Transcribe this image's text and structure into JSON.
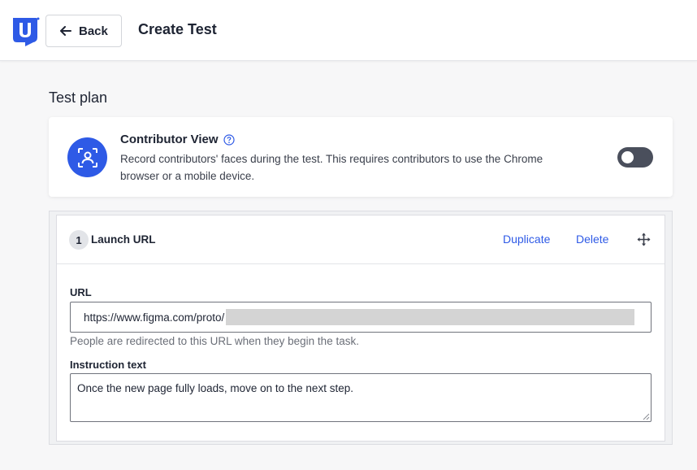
{
  "header": {
    "back_label": "Back",
    "title": "Create Test",
    "logo_icon": "usertesting-logo-icon"
  },
  "section": {
    "title": "Test plan"
  },
  "contributor_view": {
    "title": "Contributor View",
    "description": "Record contributors' faces during the test. This requires contributors to use the Chrome browser or a mobile device.",
    "icon": "contributor-face-icon",
    "help_icon": "help-icon",
    "toggle_enabled": false
  },
  "step": {
    "number": "1",
    "name": "Launch URL",
    "duplicate_label": "Duplicate",
    "delete_label": "Delete",
    "move_icon": "move-icon",
    "url_label": "URL",
    "url_value": "https://www.figma.com/proto/",
    "url_help": "People are redirected to this URL when they begin the task.",
    "instruction_label": "Instruction text",
    "instruction_value": "Once the new page fully loads, move on to the next step."
  },
  "colors": {
    "accent": "#2e5ae6",
    "toggle_off": "#4a4f5c",
    "text": "#1e2433",
    "muted": "#6b6f78"
  }
}
